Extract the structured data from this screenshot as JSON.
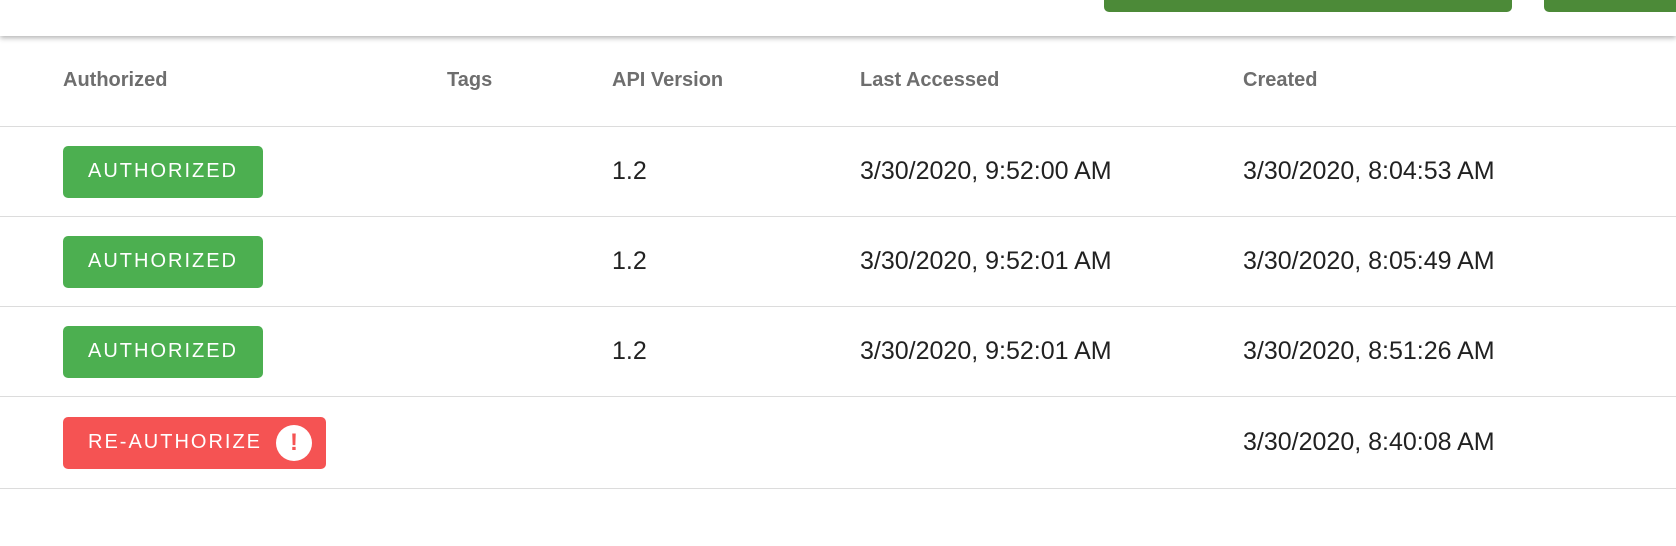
{
  "colors": {
    "authorized": "#4caf50",
    "reauthorize": "#f55353",
    "toolbar_button": "#4c8a38",
    "header_text": "#6e6e6e",
    "row_divider": "#dcdcdc"
  },
  "table": {
    "columns": {
      "authorized": "Authorized",
      "tags": "Tags",
      "api_version": "API Version",
      "last_accessed": "Last Accessed",
      "created": "Created"
    },
    "rows": [
      {
        "status": "AUTHORIZED",
        "status_type": "ok",
        "tags": "",
        "api_version": "1.2",
        "last_accessed": "3/30/2020, 9:52:00 AM",
        "created": "3/30/2020, 8:04:53 AM"
      },
      {
        "status": "AUTHORIZED",
        "status_type": "ok",
        "tags": "",
        "api_version": "1.2",
        "last_accessed": "3/30/2020, 9:52:01 AM",
        "created": "3/30/2020, 8:05:49 AM"
      },
      {
        "status": "AUTHORIZED",
        "status_type": "ok",
        "tags": "",
        "api_version": "1.2",
        "last_accessed": "3/30/2020, 9:52:01 AM",
        "created": "3/30/2020, 8:51:26 AM"
      },
      {
        "status": "RE-AUTHORIZE",
        "status_type": "warn",
        "status_icon": "exclamation-icon",
        "status_icon_glyph": "!",
        "tags": "",
        "api_version": "",
        "last_accessed": "",
        "created": "3/30/2020, 8:40:08 AM"
      }
    ]
  }
}
